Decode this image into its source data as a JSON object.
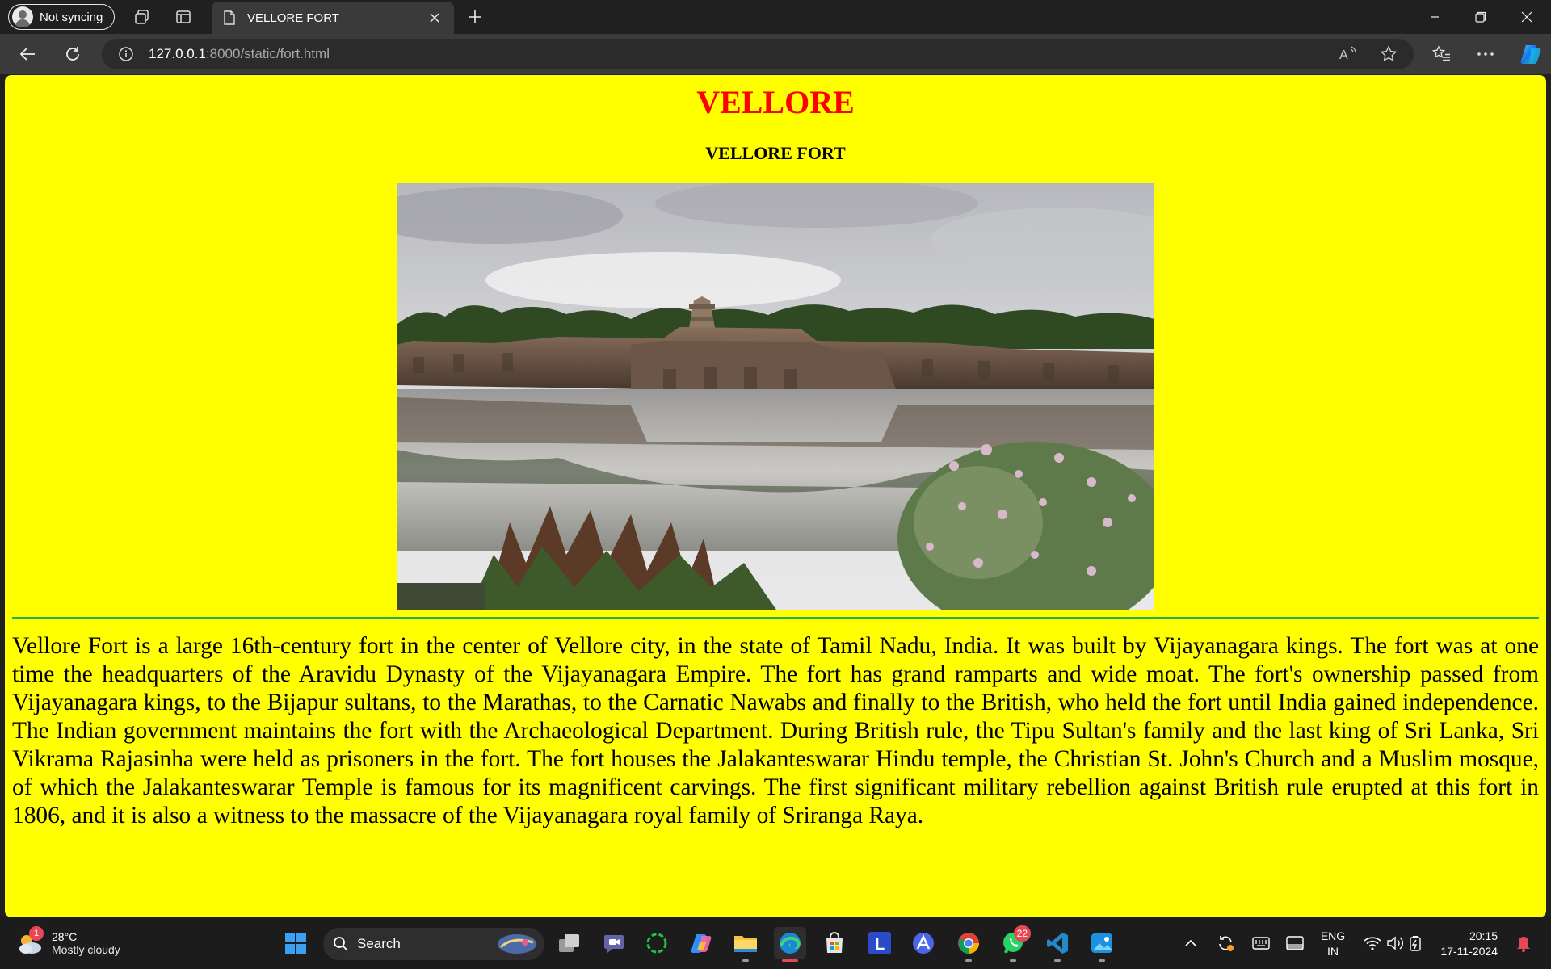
{
  "browser": {
    "profile_label": "Not syncing",
    "tab_title": "VELLORE FORT",
    "url_host": "127.0.0.1",
    "url_path": ":8000/static/fort.html"
  },
  "page": {
    "heading": "VELLORE",
    "subheading": "VELLORE FORT",
    "paragraph": "Vellore Fort is a large 16th-century fort in the center of Vellore city, in the state of Tamil Nadu, India. It was built by Vijayanagara kings. The fort was at one time the headquarters of the Aravidu Dynasty of the Vijayanagara Empire. The fort has grand ramparts and wide moat. The fort's ownership passed from Vijayanagara kings, to the Bijapur sultans, to the Marathas, to the Carnatic Nawabs and finally to the British, who held the fort until India gained independence. The Indian government maintains the fort with the Archaeological Department. During British rule, the Tipu Sultan's family and the last king of Sri Lanka, Sri Vikrama Rajasinha were held as prisoners in the fort. The fort houses the Jalakanteswarar Hindu temple, the Christian St. John's Church and a Muslim mosque, of which the Jalakanteswarar Temple is famous for its magnificent carvings. The first significant military rebellion against British rule erupted at this fort in 1806, and it is also a witness to the massacre of the Vijayanagara royal family of Sriranga Raya.",
    "colors": {
      "background": "#ffff00",
      "heading": "#ff0000",
      "divider": "#22b14c"
    }
  },
  "taskbar": {
    "weather_temp": "28°C",
    "weather_desc": "Mostly cloudy",
    "weather_badge": "1",
    "search_label": "Search",
    "whatsapp_badge": "22",
    "lang_primary": "ENG",
    "lang_secondary": "IN",
    "time": "20:15",
    "date": "17-11-2024",
    "apps": [
      "start-icon",
      "task-view-icon",
      "teams-chat-icon",
      "circle-app-icon",
      "copilot-icon",
      "file-explorer-icon",
      "edge-icon",
      "store-icon",
      "l-app-icon",
      "arc-icon",
      "chrome-icon",
      "whatsapp-icon",
      "vscode-icon",
      "photos-icon"
    ]
  }
}
